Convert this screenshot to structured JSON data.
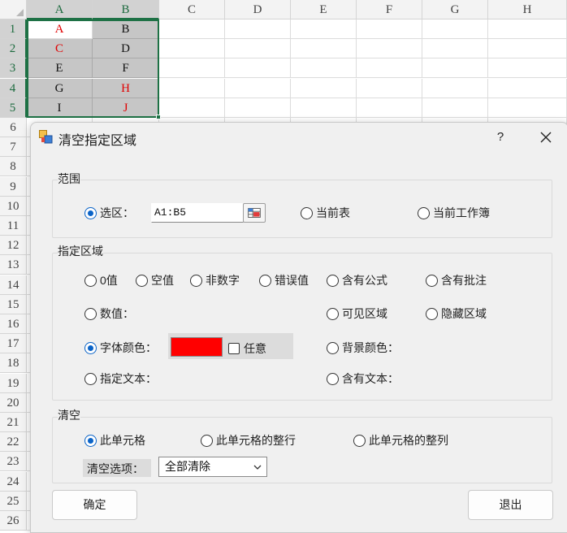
{
  "spreadsheet": {
    "columns": [
      "A",
      "B",
      "C",
      "D",
      "E",
      "F",
      "G",
      "H"
    ],
    "rows": [
      "1",
      "2",
      "3",
      "4",
      "5",
      "6",
      "7",
      "8",
      "9",
      "10",
      "11",
      "12",
      "13",
      "14",
      "15",
      "16",
      "17",
      "18",
      "19",
      "20",
      "21",
      "22",
      "23",
      "24",
      "25",
      "26"
    ],
    "cells": [
      [
        "A",
        "B"
      ],
      [
        "C",
        "D"
      ],
      [
        "E",
        "F"
      ],
      [
        "G",
        "H"
      ],
      [
        "I",
        "J"
      ]
    ],
    "red_cells": [
      "A1",
      "A2",
      "B4",
      "B5"
    ],
    "accent_color": "#1e7145",
    "font_red": "#e00000"
  },
  "dialog": {
    "title": "清空指定区域",
    "help_label": "?",
    "range_group": {
      "label": "范围",
      "selection_label": "选区：",
      "selection_value": "A1:B5",
      "current_sheet_label": "当前表",
      "current_workbook_label": "当前工作簿",
      "selected": "selection"
    },
    "area_group": {
      "label": "指定区域",
      "zero_label": "0值",
      "empty_label": "空值",
      "non_numeric_label": "非数字",
      "error_label": "错误值",
      "formula_label": "含有公式",
      "comment_label": "含有批注",
      "number_label": "数值：",
      "visible_label": "可见区域",
      "hidden_label": "隐藏区域",
      "font_color_label": "字体颜色：",
      "font_color_value": "#ff0000",
      "any_label": "任意",
      "any_checked": false,
      "bg_color_label": "背景颜色：",
      "text_label": "指定文本：",
      "contains_text_label": "含有文本：",
      "selected": "font_color"
    },
    "clear_group": {
      "label": "清空",
      "cell_label": "此单元格",
      "row_label": "此单元格的整行",
      "column_label": "此单元格的整列",
      "option_label": "清空选项：",
      "option_value": "全部清除",
      "selected": "cell"
    },
    "ok_label": "确定",
    "exit_label": "退出"
  }
}
